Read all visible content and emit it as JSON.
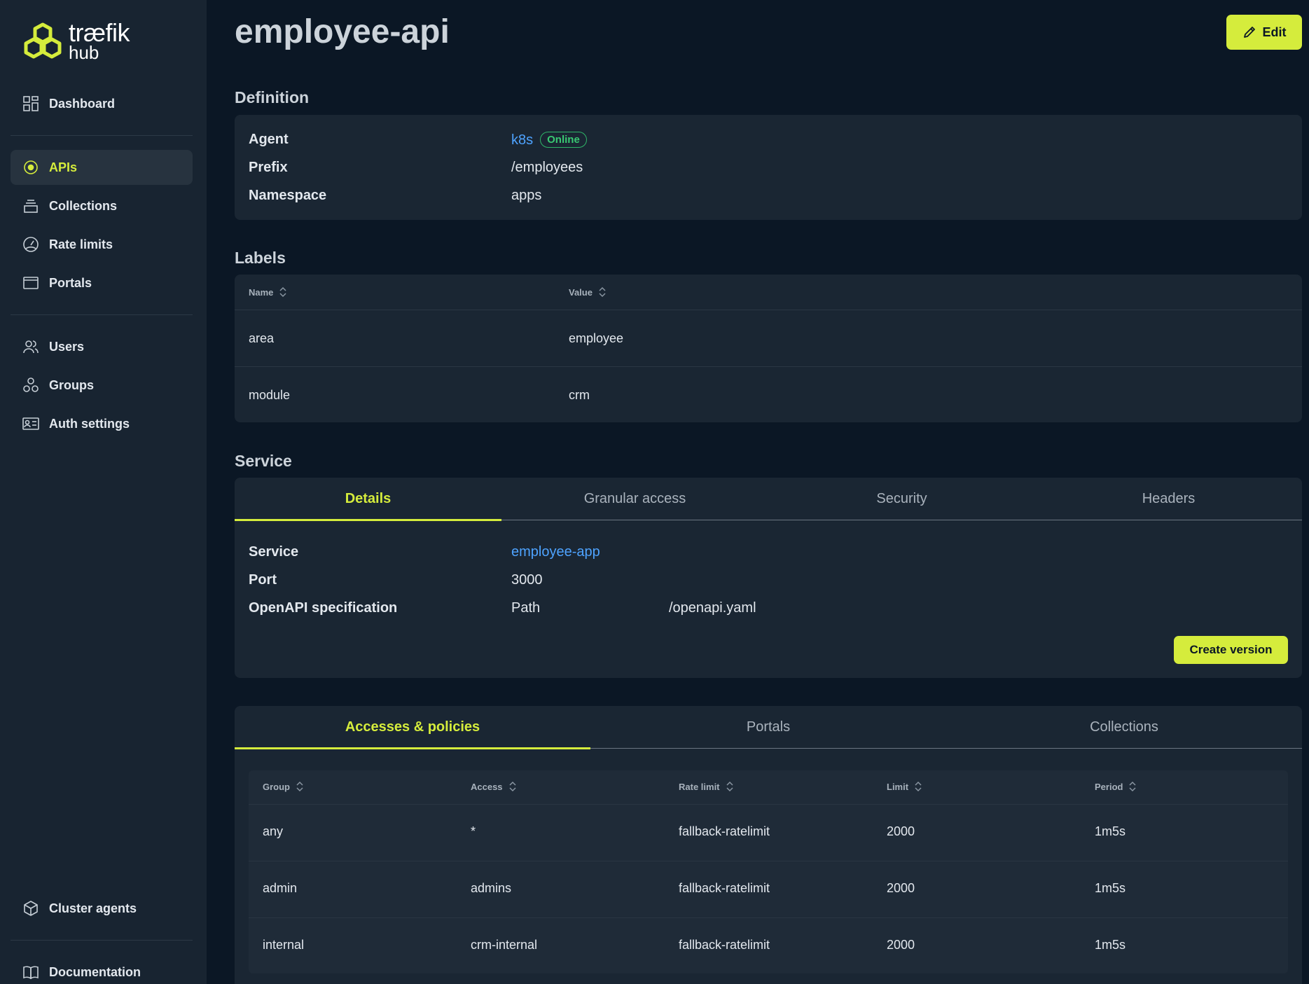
{
  "brand": {
    "name": "træfik",
    "sub": "hub"
  },
  "sidebar": {
    "items": [
      {
        "label": "Dashboard",
        "icon": "dashboard-icon"
      },
      {
        "label": "APIs",
        "icon": "api-icon",
        "active": true
      },
      {
        "label": "Collections",
        "icon": "collections-icon"
      },
      {
        "label": "Rate limits",
        "icon": "rate-limit-icon"
      },
      {
        "label": "Portals",
        "icon": "portal-icon"
      },
      {
        "label": "Users",
        "icon": "users-icon"
      },
      {
        "label": "Groups",
        "icon": "groups-icon"
      },
      {
        "label": "Auth settings",
        "icon": "auth-icon"
      },
      {
        "label": "Cluster agents",
        "icon": "cube-icon"
      },
      {
        "label": "Documentation",
        "icon": "book-icon"
      }
    ]
  },
  "header": {
    "title": "employee-api",
    "edit_label": "Edit"
  },
  "definition": {
    "heading": "Definition",
    "agent_label": "Agent",
    "agent_value": "k8s",
    "agent_status": "Online",
    "prefix_label": "Prefix",
    "prefix_value": "/employees",
    "namespace_label": "Namespace",
    "namespace_value": "apps"
  },
  "labels": {
    "heading": "Labels",
    "columns": [
      "Name",
      "Value"
    ],
    "rows": [
      {
        "name": "area",
        "value": "employee"
      },
      {
        "name": "module",
        "value": "crm"
      }
    ]
  },
  "service": {
    "heading": "Service",
    "tabs": [
      "Details",
      "Granular access",
      "Security",
      "Headers"
    ],
    "service_label": "Service",
    "service_value": "employee-app",
    "port_label": "Port",
    "port_value": "3000",
    "openapi_label": "OpenAPI specification",
    "openapi_type": "Path",
    "openapi_value": "/openapi.yaml",
    "create_version_label": "Create version"
  },
  "access": {
    "tabs": [
      "Accesses & policies",
      "Portals",
      "Collections"
    ],
    "columns": [
      "Group",
      "Access",
      "Rate limit",
      "Limit",
      "Period"
    ],
    "rows": [
      {
        "group": "any",
        "access": "*",
        "rate_limit": "fallback-ratelimit",
        "limit": "2000",
        "period": "1m5s"
      },
      {
        "group": "admin",
        "access": "admins",
        "rate_limit": "fallback-ratelimit",
        "limit": "2000",
        "period": "1m5s"
      },
      {
        "group": "internal",
        "access": "crm-internal",
        "rate_limit": "fallback-ratelimit",
        "limit": "2000",
        "period": "1m5s"
      }
    ]
  },
  "colors": {
    "accent": "#d5ec3c",
    "link": "#4ea3ff",
    "online": "#39c872",
    "background": "#0b1725",
    "sidebar": "#182431"
  }
}
